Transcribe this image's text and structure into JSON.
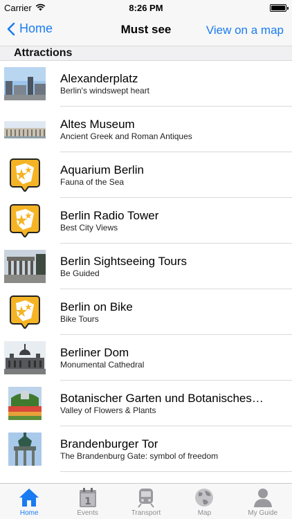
{
  "status_bar": {
    "carrier": "Carrier",
    "time": "8:26 PM"
  },
  "nav": {
    "back_label": "Home",
    "title": "Must see",
    "right_label": "View on a map"
  },
  "section": {
    "title": "Attractions"
  },
  "rows": [
    {
      "title": "Alexanderplatz",
      "subtitle": "Berlin's windswept heart",
      "thumb": "photo-square-plaza"
    },
    {
      "title": "Altes Museum",
      "subtitle": "Ancient Greek and Roman Antiques",
      "thumb": "photo-museum-facade"
    },
    {
      "title": "Aquarium Berlin",
      "subtitle": "Fauna of the Sea",
      "thumb": "app-logo-icon"
    },
    {
      "title": "Berlin Radio Tower",
      "subtitle": "Best City Views",
      "thumb": "app-logo-icon"
    },
    {
      "title": "Berlin Sightseeing Tours",
      "subtitle": "Be Guided",
      "thumb": "photo-gate-street"
    },
    {
      "title": "Berlin on Bike",
      "subtitle": "Bike Tours",
      "thumb": "app-logo-icon"
    },
    {
      "title": "Berliner Dom",
      "subtitle": "Monumental Cathedral",
      "thumb": "photo-cathedral"
    },
    {
      "title": "Botanischer Garten und Botanisches…",
      "subtitle": "Valley of Flowers & Plants",
      "thumb": "photo-garden"
    },
    {
      "title": "Brandenburger Tor",
      "subtitle": "The Brandenburg Gate: symbol of freedom",
      "thumb": "photo-quadriga"
    }
  ],
  "tabs": [
    {
      "label": "Home",
      "icon": "house-icon",
      "active": true
    },
    {
      "label": "Events",
      "icon": "calendar-icon",
      "active": false
    },
    {
      "label": "Transport",
      "icon": "train-icon",
      "active": false
    },
    {
      "label": "Map",
      "icon": "globe-icon",
      "active": false
    },
    {
      "label": "My Guide",
      "icon": "person-icon",
      "active": false
    }
  ],
  "colors": {
    "accent": "#1a7cf0",
    "logo_orange": "#f5b425",
    "inactive_tab": "#8e8e93"
  }
}
